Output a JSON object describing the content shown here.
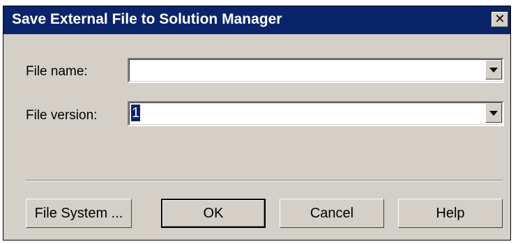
{
  "dialog": {
    "title": "Save External File to Solution Manager",
    "close_symbol": "✕"
  },
  "form": {
    "file_name": {
      "label": "File name:",
      "value": ""
    },
    "file_version": {
      "label": "File version:",
      "value": "1"
    }
  },
  "buttons": {
    "file_system": "File System ...",
    "ok": "OK",
    "cancel": "Cancel",
    "help": "Help"
  },
  "colors": {
    "titlebar": "#0a246a",
    "dialog_bg": "#d4d0c8",
    "selection": "#0a246a"
  },
  "icons": {
    "close": "close-icon",
    "dropdown": "chevron-down-icon"
  }
}
